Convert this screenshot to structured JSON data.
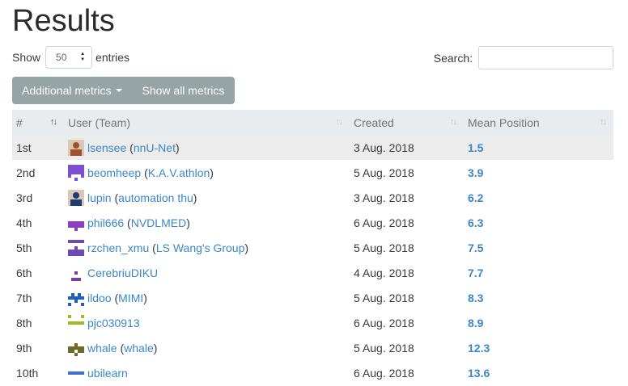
{
  "page": {
    "title": "Results"
  },
  "length": {
    "prefix": "Show",
    "value": "50",
    "suffix": "entries"
  },
  "search": {
    "label": "Search:",
    "value": ""
  },
  "buttons": {
    "metrics_label": "Additional metrics",
    "show_all_label": "Show all metrics"
  },
  "table": {
    "headers": [
      "#",
      "User (Team)",
      "Created",
      "Mean Position"
    ],
    "rows": [
      {
        "rank": "1st",
        "user": "lsensee",
        "team": "nnU-Net",
        "created": "3 Aug. 2018",
        "mean": "1.5"
      },
      {
        "rank": "2nd",
        "user": "beomheep",
        "team": "K.A.V.athlon",
        "created": "5 Aug. 2018",
        "mean": "3.9"
      },
      {
        "rank": "3rd",
        "user": "lupin",
        "team": "automation thu",
        "created": "3 Aug. 2018",
        "mean": "6.2"
      },
      {
        "rank": "4th",
        "user": "phil666",
        "team": "NVDLMED",
        "created": "6 Aug. 2018",
        "mean": "6.3"
      },
      {
        "rank": "5th",
        "user": "rzchen_xmu",
        "team": "LS Wang's Group",
        "created": "5 Aug. 2018",
        "mean": "7.5"
      },
      {
        "rank": "6th",
        "user": "CerebriuDIKU",
        "team": "",
        "created": "4 Aug. 2018",
        "mean": "7.7"
      },
      {
        "rank": "7th",
        "user": "ildoo",
        "team": "MIMI",
        "created": "5 Aug. 2018",
        "mean": "8.3"
      },
      {
        "rank": "8th",
        "user": "pjc030913",
        "team": "",
        "created": "6 Aug. 2018",
        "mean": "8.9"
      },
      {
        "rank": "9th",
        "user": "whale",
        "team": "whale",
        "created": "5 Aug. 2018",
        "mean": "12.3"
      },
      {
        "rank": "10th",
        "user": "ubilearn",
        "team": "",
        "created": "6 Aug. 2018",
        "mean": "13.6"
      }
    ]
  },
  "avatars": [
    {
      "icon": "photo-avatar-icon",
      "color": "#a0522d"
    },
    {
      "icon": "identicon-icon",
      "color": "#7b4fd0"
    },
    {
      "icon": "photo-avatar-icon",
      "color": "#1f3b73"
    },
    {
      "icon": "identicon-icon",
      "color": "#8a3fbf"
    },
    {
      "icon": "identicon-icon",
      "color": "#6d4bb6"
    },
    {
      "icon": "identicon-icon",
      "color": "#7d3f98"
    },
    {
      "icon": "identicon-icon",
      "color": "#1f5fbf"
    },
    {
      "icon": "identicon-icon",
      "color": "#9bbb30"
    },
    {
      "icon": "identicon-icon",
      "color": "#6b6b2a"
    },
    {
      "icon": "identicon-icon",
      "color": "#3f6fd0"
    }
  ],
  "colors": {
    "link": "#3a87c8",
    "button": "#95a5a6",
    "header_bg": "#e9ecef",
    "highlight_row": "#ececec"
  }
}
